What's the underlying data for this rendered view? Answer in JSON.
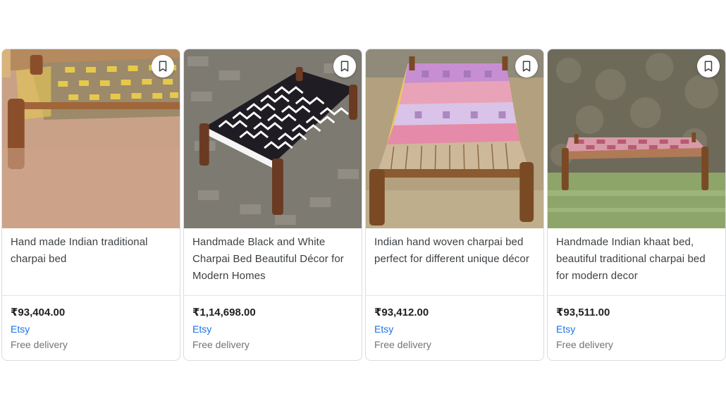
{
  "products": [
    {
      "title": "Hand made Indian traditional charpai bed",
      "price": "₹93,404.00",
      "merchant": "Etsy",
      "delivery": "Free delivery",
      "save_icon": "bookmark-icon"
    },
    {
      "title": "Handmade Black and White Charpai Bed Beautiful Décor for Modern Homes",
      "price": "₹1,14,698.00",
      "merchant": "Etsy",
      "delivery": "Free delivery",
      "save_icon": "bookmark-icon"
    },
    {
      "title": "Indian hand woven charpai bed perfect for different unique décor",
      "price": "₹93,412.00",
      "merchant": "Etsy",
      "delivery": "Free delivery",
      "save_icon": "bookmark-icon"
    },
    {
      "title": "Handmade Indian khaat bed, beautiful traditional charpai bed for modern decor",
      "price": "₹93,511.00",
      "merchant": "Etsy",
      "delivery": "Free delivery",
      "save_icon": "bookmark-icon"
    }
  ],
  "colors": {
    "merchant_link": "#1a73e8",
    "price_text": "#202124",
    "secondary_text": "#70757a",
    "card_border": "#dadce0"
  }
}
